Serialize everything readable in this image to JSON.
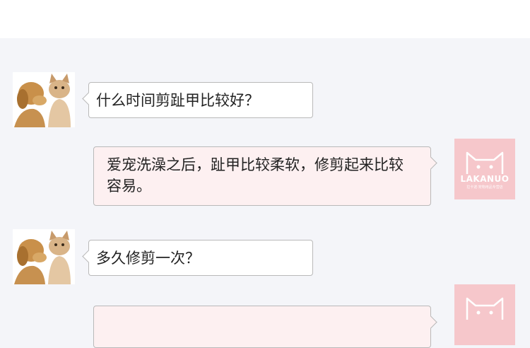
{
  "header": {
    "title": ""
  },
  "messages": [
    {
      "side": "left",
      "avatar": "dog-and-cat-avatar",
      "text": "什么时间剪趾甲比较好？"
    },
    {
      "side": "right",
      "avatar": "lakanuo-cat-logo",
      "text": "爱宠洗澡之后，趾甲比较柔软，修剪起来比较容易。"
    },
    {
      "side": "left",
      "avatar": "dog-and-cat-avatar",
      "text": "多久修剪一次？"
    },
    {
      "side": "right",
      "avatar": "lakanuo-cat-logo",
      "text": ""
    }
  ],
  "brand": {
    "name": "LAKANUO",
    "tagline": "拉卡诺·宠物用品专营店"
  },
  "colors": {
    "background": "#f4f5f9",
    "brand_pink": "#f6c7cb",
    "right_bubble": "#fdf0f1",
    "bubble_border": "#b9b9b9"
  }
}
